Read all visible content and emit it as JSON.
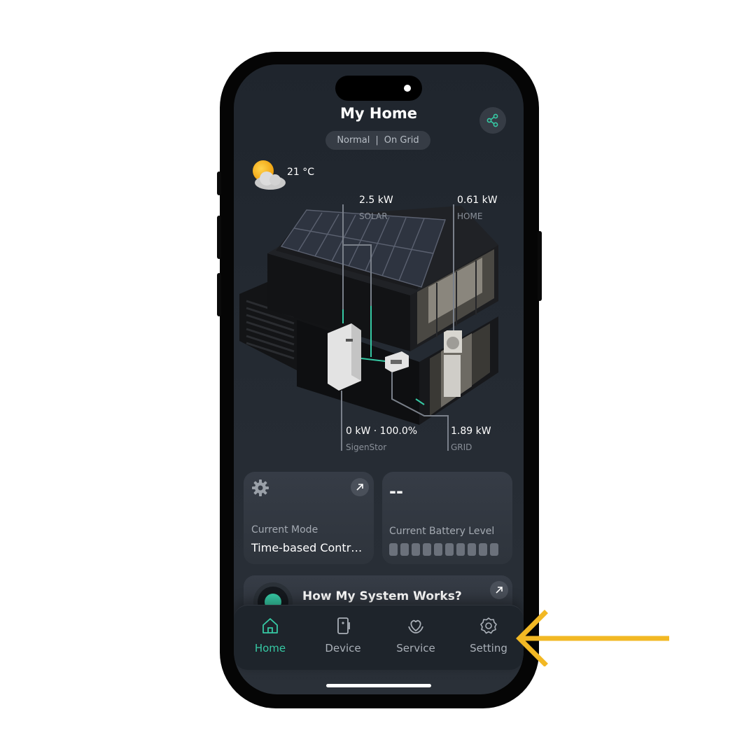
{
  "header": {
    "title": "My Home",
    "status_mode": "Normal",
    "status_separator": "|",
    "status_grid": "On Grid",
    "share_icon": "share-icon"
  },
  "weather": {
    "icon": "partly-cloudy-icon",
    "temperature": "21 °C"
  },
  "energy_flow": {
    "solar": {
      "value": "2.5 kW",
      "label": "SOLAR"
    },
    "home": {
      "value": "0.61 kW",
      "label": "HOME"
    },
    "storage": {
      "value": "0 kW · 100.0%",
      "label": "SigenStor"
    },
    "grid": {
      "value": "1.89 kW",
      "label": "GRID"
    }
  },
  "cards": {
    "mode": {
      "caption": "Current Mode",
      "value": "Time-based Contr…",
      "icon": "gear-icon"
    },
    "battery": {
      "value": "--",
      "caption": "Current Battery Level",
      "cells": 10
    },
    "how": {
      "title": "How My System Works?"
    }
  },
  "nav": {
    "items": [
      {
        "label": "Home",
        "icon": "home-icon",
        "active": true
      },
      {
        "label": "Device",
        "icon": "device-icon",
        "active": false
      },
      {
        "label": "Service",
        "icon": "service-icon",
        "active": false
      },
      {
        "label": "Setting",
        "icon": "gear-icon",
        "active": false
      }
    ]
  },
  "colors": {
    "accent": "#36c9a4",
    "annotation_arrow": "#f2b824",
    "background": "#242a32"
  }
}
